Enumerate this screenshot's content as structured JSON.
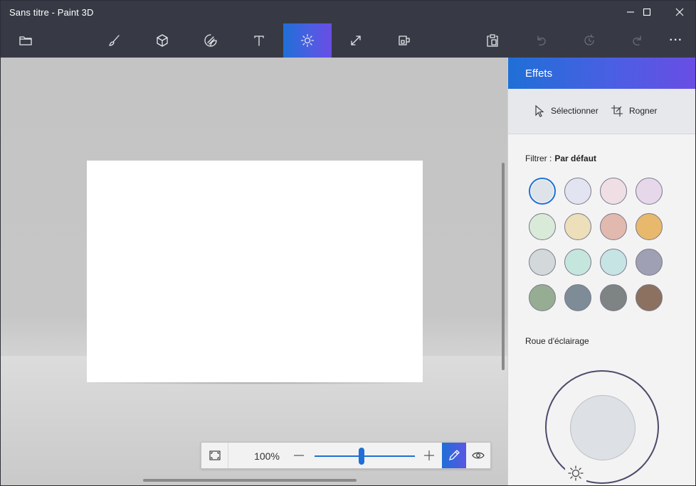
{
  "app": {
    "title": "Sans titre - Paint 3D"
  },
  "window_controls": {
    "minimize": "minimize-icon",
    "maximize": "maximize-icon",
    "close": "close-icon"
  },
  "toolbar": {
    "items": [
      {
        "name": "menu",
        "icon": "folder-icon"
      },
      {
        "name": "brushes",
        "icon": "brush-icon"
      },
      {
        "name": "3d-shapes",
        "icon": "cube-icon"
      },
      {
        "name": "stickers",
        "icon": "sticker-icon"
      },
      {
        "name": "text",
        "icon": "text-icon"
      },
      {
        "name": "effects",
        "icon": "sun-icon",
        "active": true
      },
      {
        "name": "canvas",
        "icon": "resize-icon"
      },
      {
        "name": "3d-library",
        "icon": "library-icon"
      },
      {
        "name": "paste",
        "icon": "paste-icon"
      },
      {
        "name": "undo",
        "icon": "undo-icon",
        "disabled": true
      },
      {
        "name": "history",
        "icon": "history-icon",
        "disabled": true
      },
      {
        "name": "redo",
        "icon": "redo-icon",
        "disabled": true
      },
      {
        "name": "more",
        "icon": "more-icon",
        "label": "···"
      }
    ],
    "accent": "#1f6fd6"
  },
  "zoom": {
    "percent": "100%",
    "level": 0.47
  },
  "panel": {
    "title": "Effets",
    "select_label": "Sélectionner",
    "crop_label": "Rogner",
    "filter_label": "Filtrer :",
    "filter_value": "Par défaut",
    "wheel_label": "Roue d'éclairage",
    "filters": [
      {
        "color": "#dde3e8",
        "selected": true
      },
      {
        "color": "#e3e4f1"
      },
      {
        "color": "#efdee4"
      },
      {
        "color": "#e6d8ea"
      },
      {
        "color": "#d9ebd8"
      },
      {
        "color": "#ecdfba"
      },
      {
        "color": "#e2b9ae"
      },
      {
        "color": "#e8b86c"
      },
      {
        "color": "#d3d9da"
      },
      {
        "color": "#c5e6dd"
      },
      {
        "color": "#c6e4e4"
      },
      {
        "color": "#9fa0b3"
      },
      {
        "color": "#96ad94"
      },
      {
        "color": "#7d8c97"
      },
      {
        "color": "#7e8383"
      },
      {
        "color": "#8c7060"
      }
    ]
  }
}
